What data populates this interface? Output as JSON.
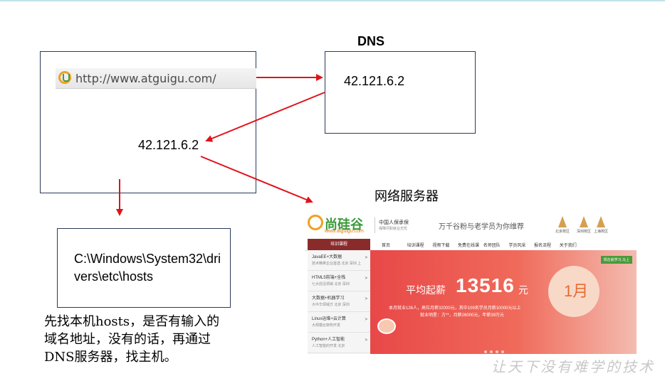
{
  "browser": {
    "url": "http://www.atguigu.com/"
  },
  "dns_label": "DNS",
  "dns_ip": "42.121.6.2",
  "resolved_ip": "42.121.6.2",
  "web_server_label": "网络服务器",
  "hosts_path": "C:\\Windows\\System32\\drivers\\etc\\hosts",
  "note_lines": [
    "先找本机hosts，是否有输入的",
    "域名地址，没有的话，再通过",
    "DNS服务器，找主机。"
  ],
  "watermark": "让天下没有难学的技术",
  "website": {
    "brand": "尚硅谷",
    "brand_sub": "www.atguigu.com",
    "partner": "中国人保承保",
    "partner_sub": "保障尽职就业无忧",
    "slogan": "万千谷粉与老学员为你维荐",
    "cities": [
      "北京校区",
      "深圳校区",
      "上海校区"
    ],
    "nav_head": "培训课程",
    "nav_items": [
      "首页",
      "培训课程",
      "视频下载",
      "免费在线课",
      "名师团队",
      "学员风采",
      "报名流程",
      "关于我们"
    ],
    "categories": [
      {
        "title": "JavaEE+大数据",
        "sub": "技术精英企业首选 北京 深圳 上"
      },
      {
        "title": "HTML5前端+全栈",
        "sub": "七大前沿领域 北京 深圳"
      },
      {
        "title": "大数据+机器学习",
        "sub": "大中华领域方 北京 深圳"
      },
      {
        "title": "Linux运维+云计算",
        "sub": "大规模云架构开发"
      },
      {
        "title": "Python+人工智能",
        "sub": "人工智能的开发 北京"
      }
    ],
    "banner": {
      "ribbon": "现在就学习,马上",
      "prefix": "平均起薪",
      "salary": "13516",
      "unit": "元",
      "line1": "本月就业126人，高位月薪32000元，其中109名学员月薪10000元以上",
      "line2": "就业明星：方**，月薪26000元，年薪39万元",
      "month": "1月"
    }
  }
}
